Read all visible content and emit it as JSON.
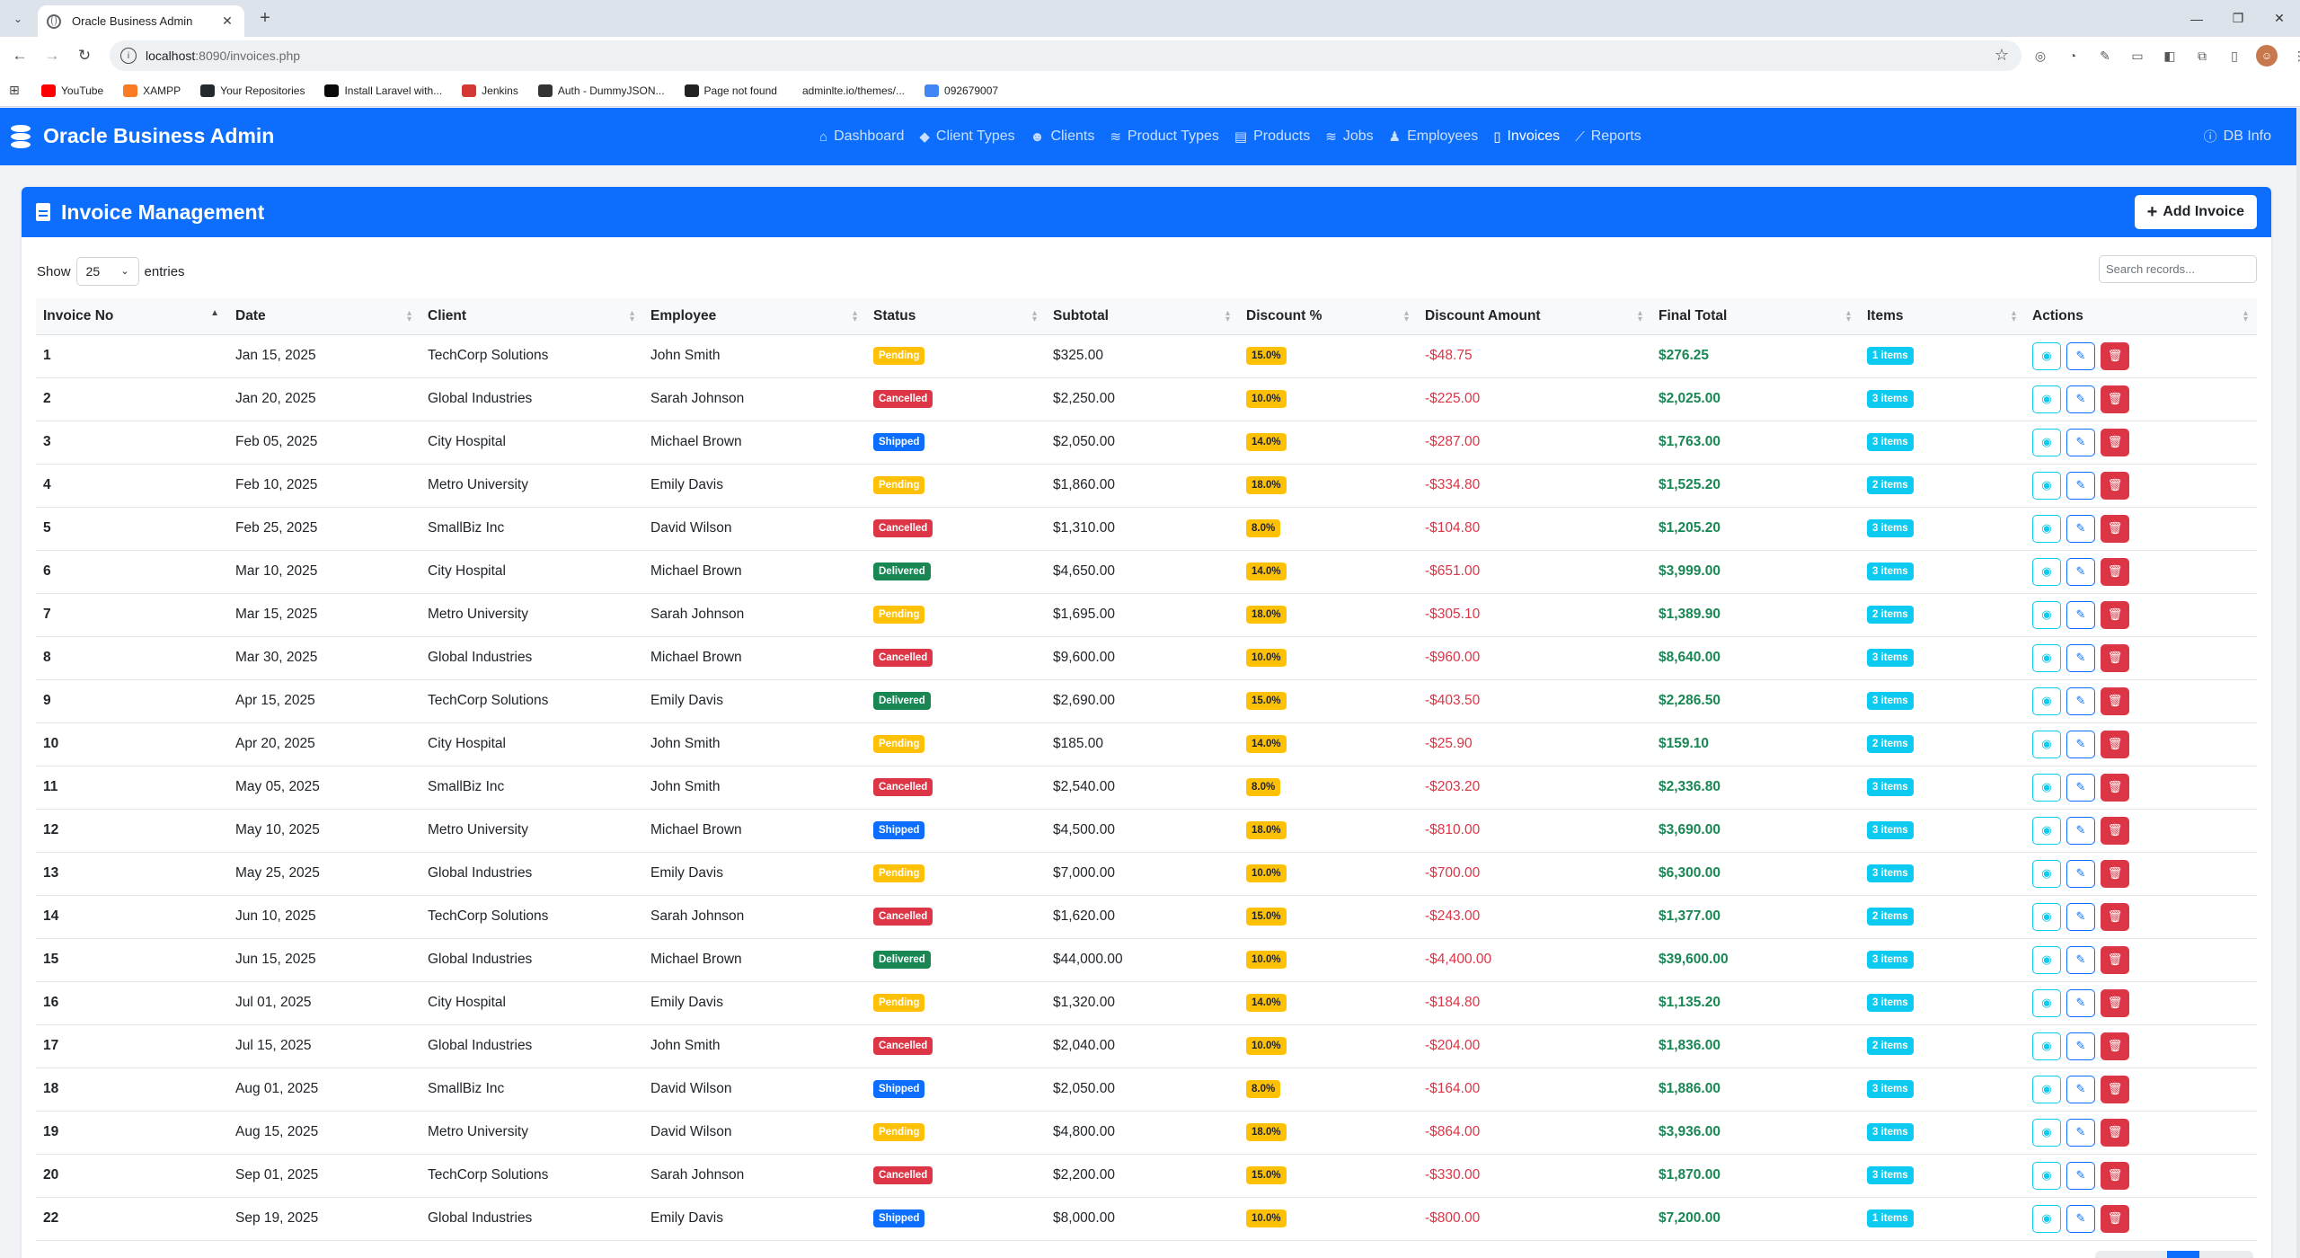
{
  "browser": {
    "tab_title": "Oracle Business Admin",
    "url_host": "localhost",
    "url_rest": ":8090/invoices.php",
    "bookmarks": [
      {
        "label": "YouTube",
        "color": "#ff0000"
      },
      {
        "label": "XAMPP",
        "color": "#fb7a24"
      },
      {
        "label": "Your Repositories",
        "color": "#24292e"
      },
      {
        "label": "Install Laravel with...",
        "color": "#0a0a0a"
      },
      {
        "label": "Jenkins",
        "color": "#d33833"
      },
      {
        "label": "Auth - DummyJSON...",
        "color": "#333333"
      },
      {
        "label": "Page not found",
        "color": "#222222"
      },
      {
        "label": "adminlte.io/themes/...",
        "color": ""
      },
      {
        "label": "092679007",
        "color": "#4285f4"
      }
    ]
  },
  "navbar": {
    "brand": "Oracle Business Admin",
    "links": [
      {
        "label": "Dashboard",
        "icon": "home-icon",
        "glyph": "⌂",
        "active": false
      },
      {
        "label": "Client Types",
        "icon": "tags-icon",
        "glyph": "◆",
        "active": false
      },
      {
        "label": "Clients",
        "icon": "users-icon",
        "glyph": "☻",
        "active": false
      },
      {
        "label": "Product Types",
        "icon": "layers-icon",
        "glyph": "≋",
        "active": false
      },
      {
        "label": "Products",
        "icon": "box-icon",
        "glyph": "▤",
        "active": false
      },
      {
        "label": "Jobs",
        "icon": "briefcase-icon",
        "glyph": "≋",
        "active": false
      },
      {
        "label": "Employees",
        "icon": "user-tie-icon",
        "glyph": "♟",
        "active": false
      },
      {
        "label": "Invoices",
        "icon": "invoice-icon",
        "glyph": "▯",
        "active": true
      },
      {
        "label": "Reports",
        "icon": "chart-line-icon",
        "glyph": "⟋",
        "active": false
      }
    ],
    "db_info": "DB Info"
  },
  "card": {
    "title": "Invoice Management",
    "add_button": "Add Invoice"
  },
  "table_controls": {
    "show_label": "Show",
    "entries_value": "25",
    "entries_label": "entries",
    "search_placeholder": "Search records..."
  },
  "columns": [
    "Invoice No",
    "Date",
    "Client",
    "Employee",
    "Status",
    "Subtotal",
    "Discount %",
    "Discount Amount",
    "Final Total",
    "Items",
    "Actions"
  ],
  "invoices": [
    {
      "no": "1",
      "date": "Jan 15, 2025",
      "client": "TechCorp Solutions",
      "employee": "John Smith",
      "status": "Pending",
      "subtotal": "$325.00",
      "discount_pct": "15.0%",
      "discount_amt": "-$48.75",
      "final_total": "$276.25",
      "items": "1 items"
    },
    {
      "no": "2",
      "date": "Jan 20, 2025",
      "client": "Global Industries",
      "employee": "Sarah Johnson",
      "status": "Cancelled",
      "subtotal": "$2,250.00",
      "discount_pct": "10.0%",
      "discount_amt": "-$225.00",
      "final_total": "$2,025.00",
      "items": "3 items"
    },
    {
      "no": "3",
      "date": "Feb 05, 2025",
      "client": "City Hospital",
      "employee": "Michael Brown",
      "status": "Shipped",
      "subtotal": "$2,050.00",
      "discount_pct": "14.0%",
      "discount_amt": "-$287.00",
      "final_total": "$1,763.00",
      "items": "3 items"
    },
    {
      "no": "4",
      "date": "Feb 10, 2025",
      "client": "Metro University",
      "employee": "Emily Davis",
      "status": "Pending",
      "subtotal": "$1,860.00",
      "discount_pct": "18.0%",
      "discount_amt": "-$334.80",
      "final_total": "$1,525.20",
      "items": "2 items"
    },
    {
      "no": "5",
      "date": "Feb 25, 2025",
      "client": "SmallBiz Inc",
      "employee": "David Wilson",
      "status": "Cancelled",
      "subtotal": "$1,310.00",
      "discount_pct": "8.0%",
      "discount_amt": "-$104.80",
      "final_total": "$1,205.20",
      "items": "3 items"
    },
    {
      "no": "6",
      "date": "Mar 10, 2025",
      "client": "City Hospital",
      "employee": "Michael Brown",
      "status": "Delivered",
      "subtotal": "$4,650.00",
      "discount_pct": "14.0%",
      "discount_amt": "-$651.00",
      "final_total": "$3,999.00",
      "items": "3 items"
    },
    {
      "no": "7",
      "date": "Mar 15, 2025",
      "client": "Metro University",
      "employee": "Sarah Johnson",
      "status": "Pending",
      "subtotal": "$1,695.00",
      "discount_pct": "18.0%",
      "discount_amt": "-$305.10",
      "final_total": "$1,389.90",
      "items": "2 items"
    },
    {
      "no": "8",
      "date": "Mar 30, 2025",
      "client": "Global Industries",
      "employee": "Michael Brown",
      "status": "Cancelled",
      "subtotal": "$9,600.00",
      "discount_pct": "10.0%",
      "discount_amt": "-$960.00",
      "final_total": "$8,640.00",
      "items": "3 items"
    },
    {
      "no": "9",
      "date": "Apr 15, 2025",
      "client": "TechCorp Solutions",
      "employee": "Emily Davis",
      "status": "Delivered",
      "subtotal": "$2,690.00",
      "discount_pct": "15.0%",
      "discount_amt": "-$403.50",
      "final_total": "$2,286.50",
      "items": "3 items"
    },
    {
      "no": "10",
      "date": "Apr 20, 2025",
      "client": "City Hospital",
      "employee": "John Smith",
      "status": "Pending",
      "subtotal": "$185.00",
      "discount_pct": "14.0%",
      "discount_amt": "-$25.90",
      "final_total": "$159.10",
      "items": "2 items"
    },
    {
      "no": "11",
      "date": "May 05, 2025",
      "client": "SmallBiz Inc",
      "employee": "John Smith",
      "status": "Cancelled",
      "subtotal": "$2,540.00",
      "discount_pct": "8.0%",
      "discount_amt": "-$203.20",
      "final_total": "$2,336.80",
      "items": "3 items"
    },
    {
      "no": "12",
      "date": "May 10, 2025",
      "client": "Metro University",
      "employee": "Michael Brown",
      "status": "Shipped",
      "subtotal": "$4,500.00",
      "discount_pct": "18.0%",
      "discount_amt": "-$810.00",
      "final_total": "$3,690.00",
      "items": "3 items"
    },
    {
      "no": "13",
      "date": "May 25, 2025",
      "client": "Global Industries",
      "employee": "Emily Davis",
      "status": "Pending",
      "subtotal": "$7,000.00",
      "discount_pct": "10.0%",
      "discount_amt": "-$700.00",
      "final_total": "$6,300.00",
      "items": "3 items"
    },
    {
      "no": "14",
      "date": "Jun 10, 2025",
      "client": "TechCorp Solutions",
      "employee": "Sarah Johnson",
      "status": "Cancelled",
      "subtotal": "$1,620.00",
      "discount_pct": "15.0%",
      "discount_amt": "-$243.00",
      "final_total": "$1,377.00",
      "items": "2 items"
    },
    {
      "no": "15",
      "date": "Jun 15, 2025",
      "client": "Global Industries",
      "employee": "Michael Brown",
      "status": "Delivered",
      "subtotal": "$44,000.00",
      "discount_pct": "10.0%",
      "discount_amt": "-$4,400.00",
      "final_total": "$39,600.00",
      "items": "3 items"
    },
    {
      "no": "16",
      "date": "Jul 01, 2025",
      "client": "City Hospital",
      "employee": "Emily Davis",
      "status": "Pending",
      "subtotal": "$1,320.00",
      "discount_pct": "14.0%",
      "discount_amt": "-$184.80",
      "final_total": "$1,135.20",
      "items": "3 items"
    },
    {
      "no": "17",
      "date": "Jul 15, 2025",
      "client": "Global Industries",
      "employee": "John Smith",
      "status": "Cancelled",
      "subtotal": "$2,040.00",
      "discount_pct": "10.0%",
      "discount_amt": "-$204.00",
      "final_total": "$1,836.00",
      "items": "2 items"
    },
    {
      "no": "18",
      "date": "Aug 01, 2025",
      "client": "SmallBiz Inc",
      "employee": "David Wilson",
      "status": "Shipped",
      "subtotal": "$2,050.00",
      "discount_pct": "8.0%",
      "discount_amt": "-$164.00",
      "final_total": "$1,886.00",
      "items": "3 items"
    },
    {
      "no": "19",
      "date": "Aug 15, 2025",
      "client": "Metro University",
      "employee": "David Wilson",
      "status": "Pending",
      "subtotal": "$4,800.00",
      "discount_pct": "18.0%",
      "discount_amt": "-$864.00",
      "final_total": "$3,936.00",
      "items": "3 items"
    },
    {
      "no": "20",
      "date": "Sep 01, 2025",
      "client": "TechCorp Solutions",
      "employee": "Sarah Johnson",
      "status": "Cancelled",
      "subtotal": "$2,200.00",
      "discount_pct": "15.0%",
      "discount_amt": "-$330.00",
      "final_total": "$1,870.00",
      "items": "3 items"
    },
    {
      "no": "22",
      "date": "Sep 19, 2025",
      "client": "Global Industries",
      "employee": "Emily Davis",
      "status": "Shipped",
      "subtotal": "$8,000.00",
      "discount_pct": "10.0%",
      "discount_amt": "-$800.00",
      "final_total": "$7,200.00",
      "items": "1 items"
    }
  ],
  "colors": {
    "primary": "#0d6efd",
    "pending": "#ffc107",
    "cancelled": "#dc3545",
    "shipped": "#0d6efd",
    "delivered": "#198754",
    "items": "#0dcaf0",
    "negative": "#dc3545",
    "positive": "#198754"
  }
}
